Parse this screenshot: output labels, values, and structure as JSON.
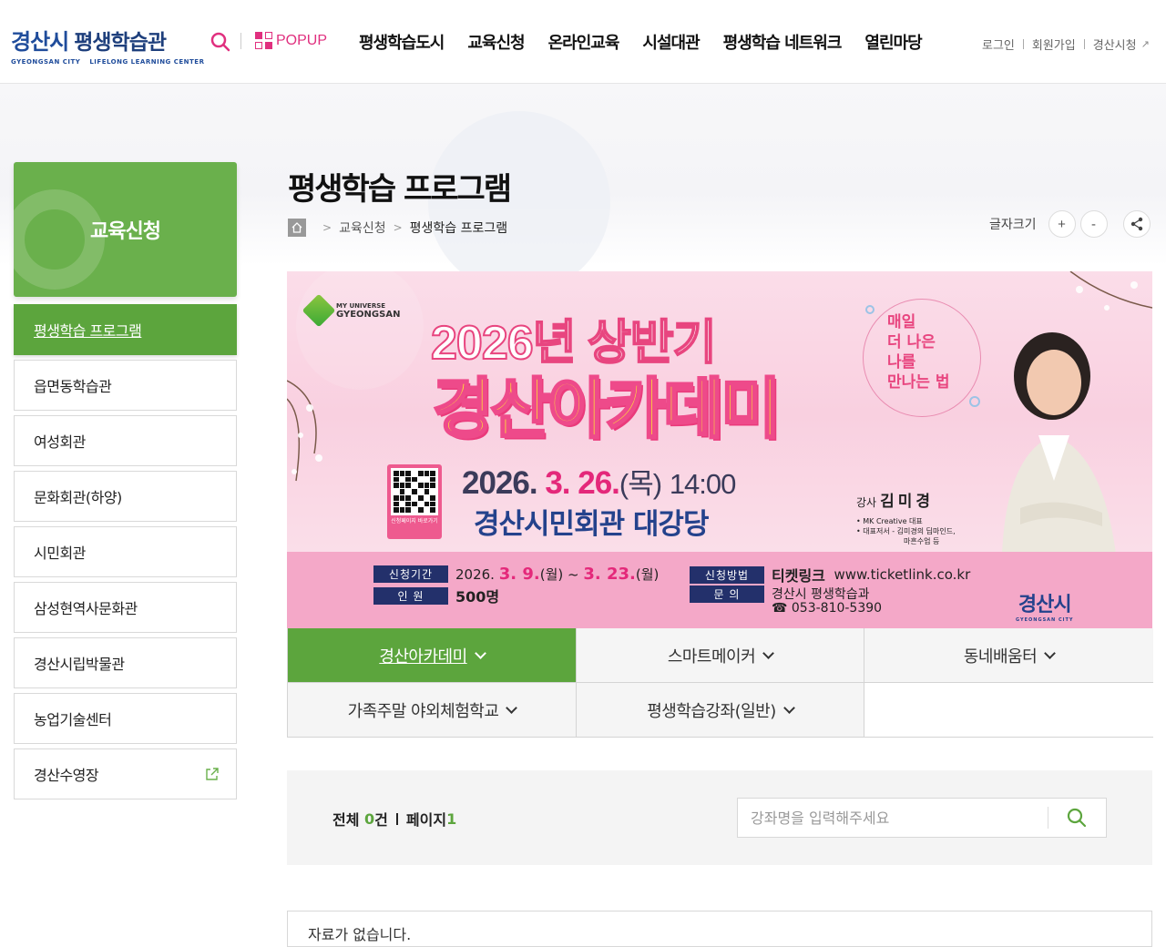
{
  "header": {
    "logo_city": "경산시",
    "logo_center": "평생학습관",
    "logo_sub_city": "GYEONGSAN CITY",
    "logo_sub_center": "LIFELONG LEARNING CENTER",
    "popup_label": "POPUP",
    "nav": [
      "평생학습도시",
      "교육신청",
      "온라인교육",
      "시설대관",
      "평생학습 네트워크",
      "열린마당"
    ],
    "util": {
      "login": "로그인",
      "join": "회원가입",
      "city_site": "경산시청",
      "city_site_icon": "↗"
    }
  },
  "sidebar": {
    "title": "교육신청",
    "items": [
      {
        "label": "평생학습 프로그램",
        "active": true
      },
      {
        "label": "읍면동학습관"
      },
      {
        "label": "여성회관"
      },
      {
        "label": "문화회관(하양)"
      },
      {
        "label": "시민회관"
      },
      {
        "label": "삼성현역사문화관"
      },
      {
        "label": "경산시립박물관"
      },
      {
        "label": "농업기술센터"
      },
      {
        "label": "경산수영장",
        "external": true
      }
    ]
  },
  "page": {
    "title": "평생학습 프로그램",
    "breadcrumb": [
      "교육신청",
      "평생학습 프로그램"
    ],
    "font_size_label": "글자크기",
    "font_plus": "+",
    "font_minus": "-"
  },
  "banner": {
    "logo_top": "MY UNIVERSE",
    "logo_main": "GYEONGSAN",
    "line1": "2026년 상반기",
    "line2": "경산아카데미",
    "slogan": [
      "매일",
      "더 나은",
      "나를",
      "만나는 법"
    ],
    "qr_caption": "신청페이지 바로가기",
    "date_year": "2026.",
    "date_md": "3. 26.",
    "date_day": "(목)",
    "date_time": "14:00",
    "venue": "경산시민회관 대강당",
    "lecturer_label": "강사",
    "lecturer_name": "김미경",
    "lecturer_line1": "• MK Creative 대표",
    "lecturer_line2": "• 대표저서 - 김미경의 딥마인드,",
    "lecturer_line3": "마흔수업 등",
    "period_tag": "신청기간",
    "period_y": "2026.",
    "period_start": "3. 9.",
    "period_start_day": "(월) ~",
    "period_end": "3. 23.",
    "period_end_day": "(월)",
    "capacity_tag": "인  원",
    "capacity": "500명",
    "method_tag": "신청방법",
    "method_name": "티켓링크",
    "method_url": "www.ticketlink.co.kr",
    "inquiry_tag": "문  의",
    "inquiry_org": "경산시 평생학습과",
    "inquiry_tel": "☎ 053-810-5390",
    "city_logo": "경산시",
    "city_logo_sub": "GYEONGSAN CITY"
  },
  "tabs": [
    {
      "label": "경산아카데미",
      "active": true
    },
    {
      "label": "스마트메이커"
    },
    {
      "label": "동네배움터"
    },
    {
      "label": "가족주말 야외체험학교"
    },
    {
      "label": "평생학습강좌(일반)"
    }
  ],
  "list": {
    "total_label": "전체",
    "total_count": "0",
    "total_unit": "건",
    "page_label": "페이지",
    "page_num": "1",
    "search_placeholder": "강좌명을 입력해주세요",
    "no_data": "자료가 없습니다."
  },
  "colors": {
    "primary_green": "#5ca53d",
    "navy": "#1f4c9b",
    "pink": "#e4287a"
  }
}
